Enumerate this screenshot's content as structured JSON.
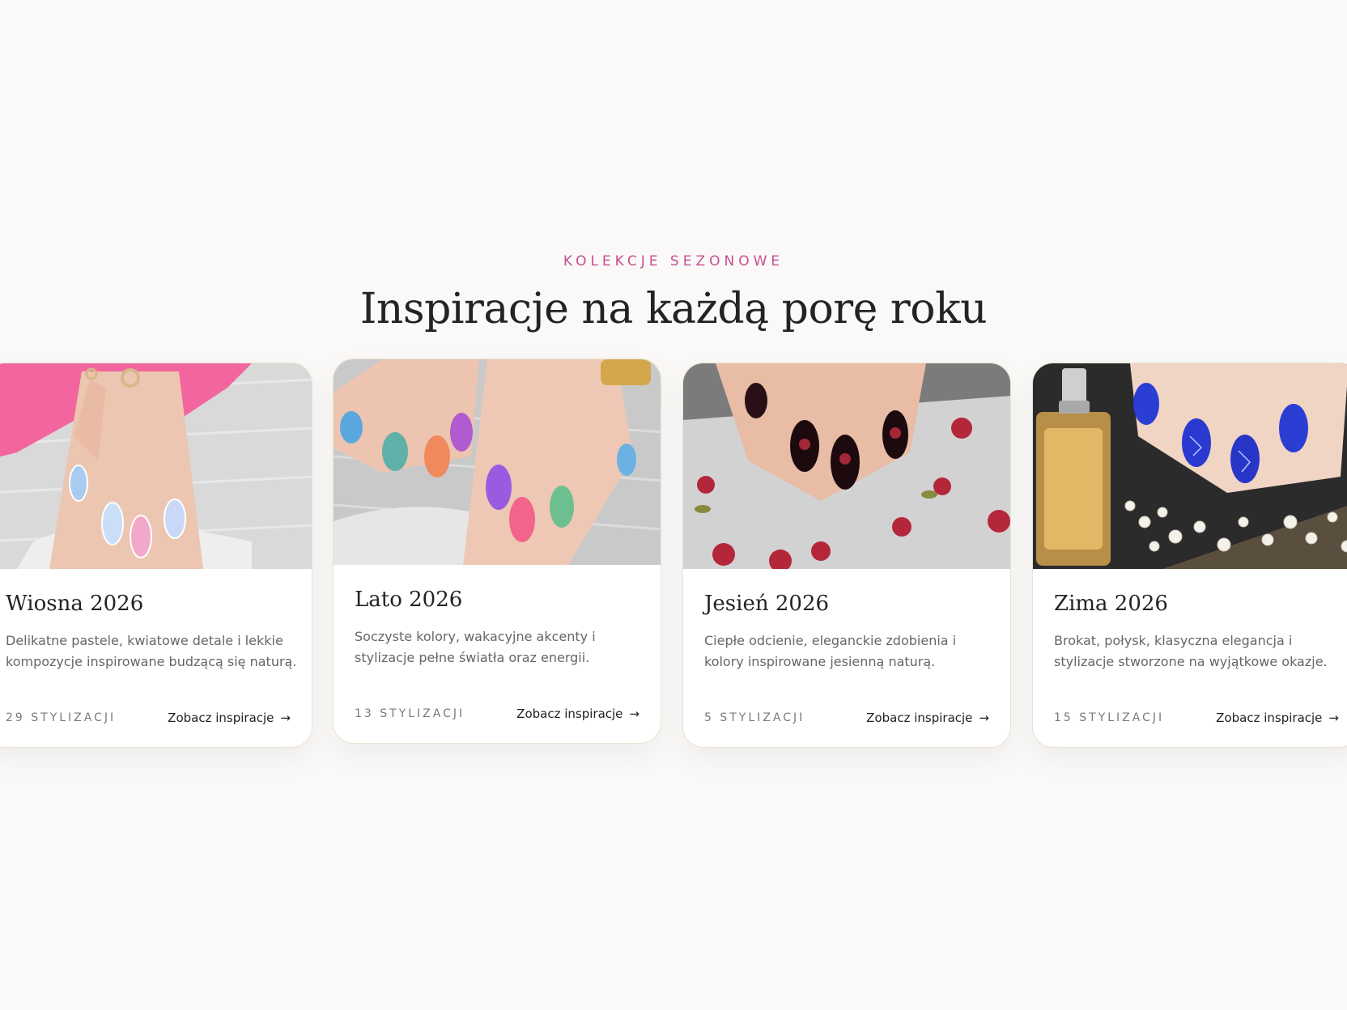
{
  "section": {
    "eyebrow": "KOLEKCJE SEZONOWE",
    "headline": "Inspiracje na każdą porę roku"
  },
  "cards": [
    {
      "title": "Wiosna 2026",
      "description": "Delikatne pastele, kwiatowe detale i lekkie kompozycje inspirowane budzącą się naturą.",
      "count": "29 STYLIZACJI",
      "link": "Zobacz inspiracje",
      "arrow_icon": "arrow-right-icon"
    },
    {
      "title": "Lato 2026",
      "description": "Soczyste kolory, wakacyjne akcenty i stylizacje pełne światła oraz energii.",
      "count": "13 STYLIZACJI",
      "link": "Zobacz inspiracje",
      "arrow_icon": "arrow-right-icon"
    },
    {
      "title": "Jesień 2026",
      "description": "Ciepłe odcienie, eleganckie zdobienia i kolory inspirowane jesienną naturą.",
      "count": "5 STYLIZACJI",
      "link": "Zobacz inspiracje",
      "arrow_icon": "arrow-right-icon"
    },
    {
      "title": "Zima 2026",
      "description": "Brokat, połysk, klasyczna elegancja i stylizacje stworzone na wyjątkowe okazje.",
      "count": "15 STYLIZACJI",
      "link": "Zobacz inspiracje",
      "arrow_icon": "arrow-right-icon"
    }
  ],
  "colors": {
    "accent": "#c64e8f",
    "heading": "#232323",
    "background": "#faf9f8",
    "card_border": "#ebe2d3"
  }
}
